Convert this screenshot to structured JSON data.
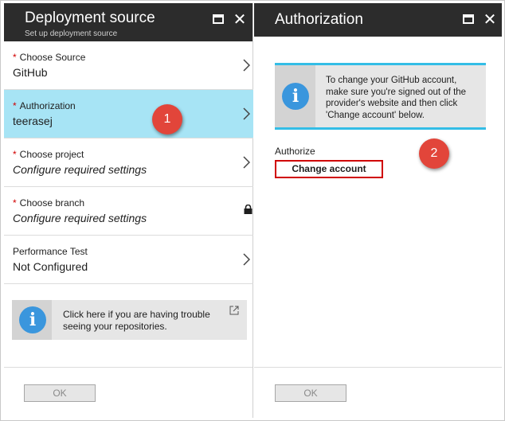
{
  "left_blade": {
    "title": "Deployment source",
    "subtitle": "Set up deployment source",
    "rows": [
      {
        "label": "Choose Source",
        "value": "GitHub",
        "required": "*"
      },
      {
        "label": "Authorization",
        "value": "teerasej",
        "required": "*"
      },
      {
        "label": "Choose project",
        "value": "Configure required settings",
        "required": "*"
      },
      {
        "label": "Choose branch",
        "value": "Configure required settings",
        "required": "*"
      },
      {
        "label": "Performance Test",
        "value": "Not Configured"
      }
    ],
    "info_text_line1": "Click here if you are having trouble",
    "info_text_line2": "seeing your repositories.",
    "ok_label": "OK",
    "badge": "1"
  },
  "right_blade": {
    "title": "Authorization",
    "info_lines": [
      "To change your GitHub account,",
      "make sure you're signed out of the",
      "provider's website and then click",
      "'Change account' below."
    ],
    "authorize_label": "Authorize",
    "change_account_label": "Change account",
    "ok_label": "OK",
    "badge": "2"
  },
  "colors": {
    "header_bg": "#2c2c2c",
    "selected_row_bg": "#a7e4f5",
    "info_accent": "#3a96dd",
    "info_border": "#33bde6",
    "badge": "#e2453a",
    "change_account_border": "#d00000",
    "required_star": "#d10000"
  },
  "icons": {
    "maximize": "maximize-icon",
    "close": "close-icon",
    "chevron": "chevron-right-icon",
    "lock": "lock-icon",
    "info": "info-icon",
    "external_link": "external-link-icon"
  }
}
